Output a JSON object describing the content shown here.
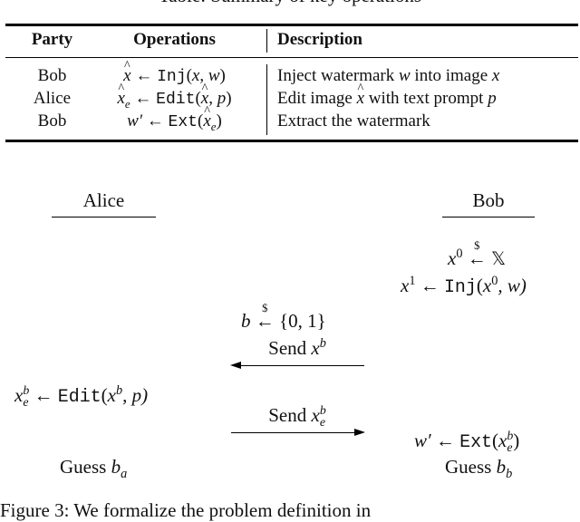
{
  "top_caption_clipped": "Table: Summary of key operations",
  "table": {
    "headers": [
      "Party",
      "Operations",
      "Description"
    ],
    "rows": [
      {
        "party": "Bob",
        "op_lhs": "x̂",
        "op_fn": "Inj",
        "op_args": "(x, w)",
        "description": "Inject watermark w into image x"
      },
      {
        "party": "Alice",
        "op_lhs": "x̂_e",
        "op_fn": "Edit",
        "op_args": "(x̂, p)",
        "description": "Edit image x̂ with text prompt p"
      },
      {
        "party": "Bob",
        "op_lhs": "w′",
        "op_fn": "Ext",
        "op_args": "(x̂_e)",
        "description": "Extract the watermark"
      }
    ],
    "desc_parts": {
      "r1_a": "Inject watermark ",
      "r1_w": "w",
      "r1_b": " into image ",
      "r1_x": "x",
      "r2_a": "Edit image ",
      "r2_x": "x",
      "r2_b": " with text prompt ",
      "r2_p": "p",
      "r3": "Extract the watermark"
    },
    "arrow": "←"
  },
  "diagram": {
    "alice_label": "Alice",
    "bob_label": "Bob",
    "bob_step1": {
      "lhs": "x",
      "lhs_sup": "0",
      "arrow": "←",
      "over": "$",
      "rhs": "𝕏"
    },
    "bob_step2": {
      "lhs": "x",
      "lhs_sup": "1",
      "fn": "Inj",
      "open": "(",
      "arg": "x",
      "arg_sup": "0",
      "rest": ", w)"
    },
    "sample_b": {
      "lhs": "b",
      "arrow": "←",
      "over": "$",
      "rhs": "{0, 1}"
    },
    "send1": {
      "label": "Send ",
      "var": "x",
      "sup": "b",
      "direction": "left"
    },
    "alice_edit": {
      "lhs": "x",
      "sup": "b",
      "sub": "e",
      "fn": "Edit",
      "open": "(",
      "arg": "x",
      "arg_sup": "b",
      "rest": ", p)"
    },
    "send2": {
      "label": "Send ",
      "var": "x",
      "sup": "b",
      "sub": "e",
      "direction": "right"
    },
    "bob_extract": {
      "lhs": "w′",
      "fn": "Ext",
      "open": "(",
      "arg": "x",
      "sup": "b",
      "sub": "e",
      "close": ")"
    },
    "alice_guess": {
      "label": "Guess ",
      "var": "b",
      "sub": "a"
    },
    "bob_guess": {
      "label": "Guess ",
      "var": "b",
      "sub": "b"
    }
  },
  "bottom_caption_clipped": "Figure 3: We formalize the problem definition in"
}
